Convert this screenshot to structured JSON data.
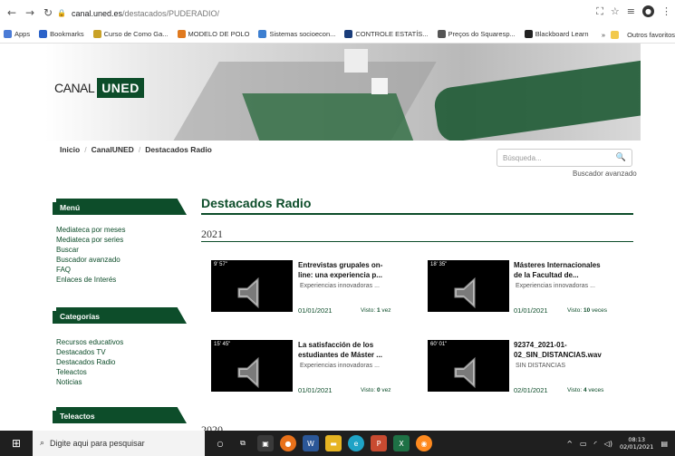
{
  "browser": {
    "url_host": "canal.uned.es",
    "url_path": "/destacados/PUDERADIO/",
    "bookmarks": [
      {
        "label": "Apps"
      },
      {
        "label": "Bookmarks"
      },
      {
        "label": "Curso de Como Ga..."
      },
      {
        "label": "MODELO DE POLO"
      },
      {
        "label": "Sistemas socioecon..."
      },
      {
        "label": "CONTROLE ESTATÍS..."
      },
      {
        "label": "Preços do Squaresp..."
      },
      {
        "label": "Blackboard Learn"
      }
    ],
    "overflow": "»",
    "other_bookmarks": "Outros favoritos"
  },
  "site": {
    "logo_canal": "CANAL",
    "logo_uned": "UNED",
    "breadcrumb": [
      "Inicio",
      "CanalUNED",
      "Destacados Radio"
    ],
    "search_placeholder": "Búsqueda...",
    "advanced_search": "Buscador avanzado"
  },
  "sidebar": {
    "menu_title": "Menú",
    "menu_items": [
      "Mediateca por meses",
      "Mediateca por series",
      "Buscar",
      "Buscador avanzado",
      "FAQ",
      "Enlaces de Interés"
    ],
    "categories_title": "Categorías",
    "categories_items": [
      "Recursos educativos",
      "Destacados TV",
      "Destacados Radio",
      "Teleactos",
      "Noticias"
    ],
    "teleactos_title": "Teleactos"
  },
  "main": {
    "title": "Destacados Radio",
    "year_2021": "2021",
    "year_2020": "2020",
    "cards": [
      {
        "duration": "9' 57\"",
        "title_line1": "Entrevistas grupales on-",
        "title_line2": "line: una experiencia p...",
        "subtitle": "Experiencias innovadoras ...",
        "date": "01/01/2021",
        "views_prefix": "Visto:",
        "views_count": "1",
        "views_suffix": "vez"
      },
      {
        "duration": "18' 35\"",
        "title_line1": "Másteres Internacionales",
        "title_line2": "de la Facultad de...",
        "subtitle": "Experiencias innovadoras ...",
        "date": "01/01/2021",
        "views_prefix": "Visto:",
        "views_count": "10",
        "views_suffix": "veces"
      },
      {
        "duration": "15' 45\"",
        "title_line1": "La satisfacción de los",
        "title_line2": "estudiantes de Máster ...",
        "subtitle": "Experiencias innovadoras ...",
        "date": "01/01/2021",
        "views_prefix": "Visto:",
        "views_count": "0",
        "views_suffix": "vez"
      },
      {
        "duration": "60' 01\"",
        "title_line1": "92374_2021-01-",
        "title_line2": "02_SIN_DISTANCIAS.wav",
        "subtitle": "SIN DISTANCIAS",
        "date": "02/01/2021",
        "views_prefix": "Visto:",
        "views_count": "4",
        "views_suffix": "veces"
      }
    ]
  },
  "taskbar": {
    "search_placeholder": "Digite aqui para pesquisar",
    "time": "08:13",
    "date": "02/01/2021"
  }
}
